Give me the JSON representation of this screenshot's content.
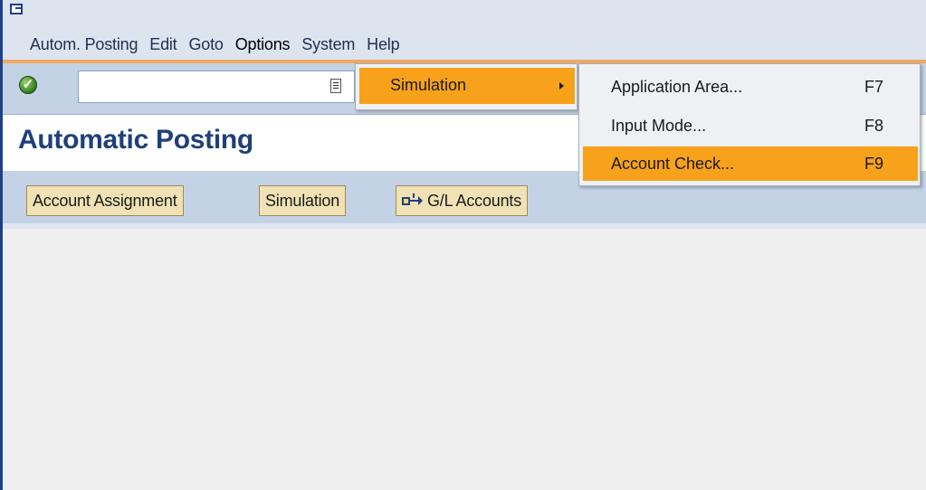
{
  "menubar": {
    "items": [
      {
        "label": "Autom. Posting"
      },
      {
        "label": "Edit"
      },
      {
        "label": "Goto"
      },
      {
        "label": "Options"
      },
      {
        "label": "System"
      },
      {
        "label": "Help"
      }
    ]
  },
  "toolbar": {
    "command_value": "",
    "ok_icon": "green-checkmark-icon"
  },
  "page": {
    "title": "Automatic Posting"
  },
  "app_toolbar": {
    "buttons": [
      {
        "label": "Account Assignment"
      },
      {
        "label": "Simulation"
      },
      {
        "label": "G/L Accounts",
        "icon": "gl-accounts-icon"
      }
    ]
  },
  "options_menu": {
    "items": [
      {
        "label": "Simulation",
        "has_submenu": true
      }
    ]
  },
  "simulation_submenu": {
    "items": [
      {
        "label": "Application Area...",
        "shortcut": "F7"
      },
      {
        "label": "Input Mode...",
        "shortcut": "F8"
      },
      {
        "label": "Account Check...",
        "shortcut": "F9",
        "selected": true
      }
    ]
  },
  "colors": {
    "highlight": "#f7a21a",
    "toolbar": "#c4d2e6",
    "title": "#1f3f7a",
    "button": "#f0e2b4"
  }
}
